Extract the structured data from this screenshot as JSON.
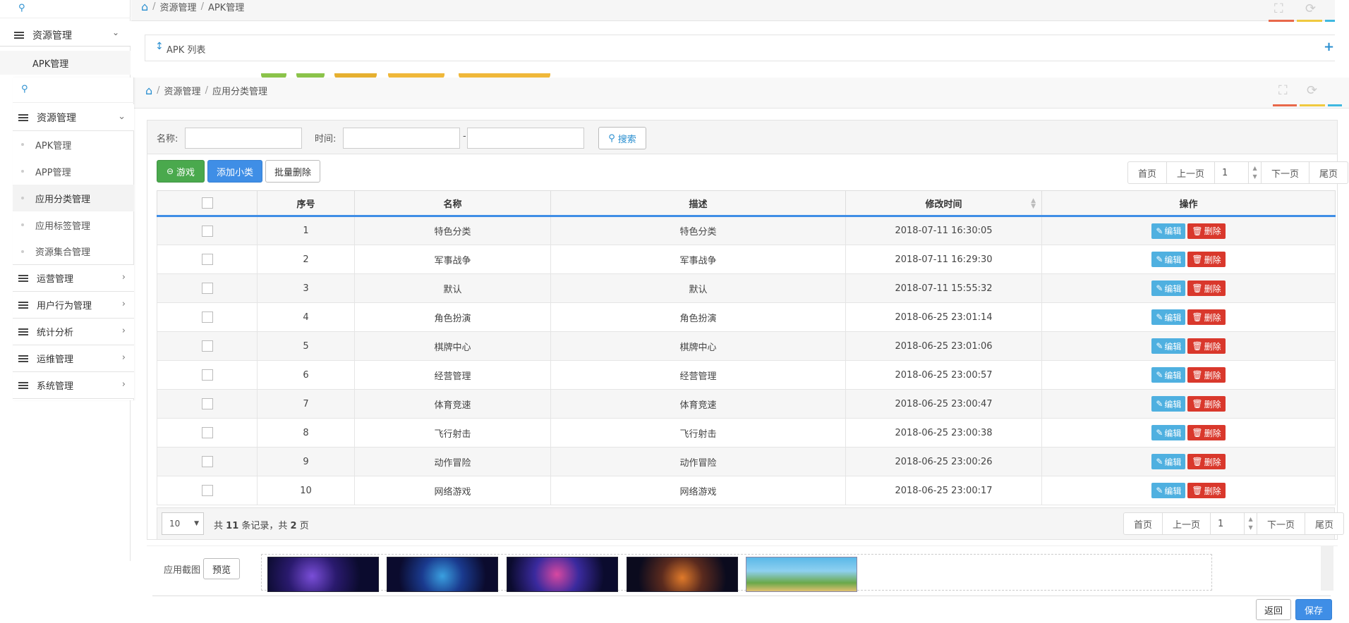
{
  "back": {
    "breadcrumb": [
      "资源管理",
      "APK管理"
    ],
    "menu_head": "资源管理",
    "sub_item": "APK管理",
    "apk_bar_title": "APK 列表"
  },
  "sidebar": {
    "section": "资源管理",
    "sub_items": [
      "APK管理",
      "APP管理",
      "应用分类管理",
      "应用标签管理",
      "资源集合管理"
    ],
    "active_index": 2,
    "groups": [
      "运营管理",
      "用户行为管理",
      "统计分析",
      "运维管理",
      "系统管理"
    ]
  },
  "breadcrumb": [
    "资源管理",
    "应用分类管理"
  ],
  "filter": {
    "name_label": "名称:",
    "time_label": "时间:",
    "dash": "-",
    "search_label": "搜索"
  },
  "toolbar": {
    "game_label": "游戏",
    "add_sub_label": "添加小类",
    "batch_delete_label": "批量删除"
  },
  "pager": {
    "first": "首页",
    "prev": "上一页",
    "page": "1",
    "next": "下一页",
    "last": "尾页"
  },
  "table": {
    "columns": [
      "序号",
      "名称",
      "描述",
      "修改时间",
      "操作"
    ],
    "edit_label": "编辑",
    "delete_label": "删除",
    "rows": [
      {
        "no": "1",
        "name": "特色分类",
        "desc": "特色分类",
        "time": "2018-07-11 16:30:05"
      },
      {
        "no": "2",
        "name": "军事战争",
        "desc": "军事战争",
        "time": "2018-07-11 16:29:30"
      },
      {
        "no": "3",
        "name": "默认",
        "desc": "默认",
        "time": "2018-07-11 15:55:32"
      },
      {
        "no": "4",
        "name": "角色扮演",
        "desc": "角色扮演",
        "time": "2018-06-25 23:01:14"
      },
      {
        "no": "5",
        "name": "棋牌中心",
        "desc": "棋牌中心",
        "time": "2018-06-25 23:01:06"
      },
      {
        "no": "6",
        "name": "经营管理",
        "desc": "经营管理",
        "time": "2018-06-25 23:00:57"
      },
      {
        "no": "7",
        "name": "体育竞速",
        "desc": "体育竞速",
        "time": "2018-06-25 23:00:47"
      },
      {
        "no": "8",
        "name": "飞行射击",
        "desc": "飞行射击",
        "time": "2018-06-25 23:00:38"
      },
      {
        "no": "9",
        "name": "动作冒险",
        "desc": "动作冒险",
        "time": "2018-06-25 23:00:26"
      },
      {
        "no": "10",
        "name": "网络游戏",
        "desc": "网络游戏",
        "time": "2018-06-25 23:00:17"
      }
    ]
  },
  "footer": {
    "page_size": "10",
    "summary_prefix": "共",
    "total_records": "11",
    "summary_mid": "条记录，共",
    "total_pages": "2",
    "summary_suffix": "页"
  },
  "screenshots": {
    "label": "应用截图",
    "preview_label": "预览"
  },
  "actions": {
    "back_label": "返回",
    "save_label": "保存"
  },
  "colors": {
    "accent": "#3f8ee6",
    "green": "#4aa94d",
    "edit": "#4fb0e0",
    "delete": "#d9382c"
  }
}
